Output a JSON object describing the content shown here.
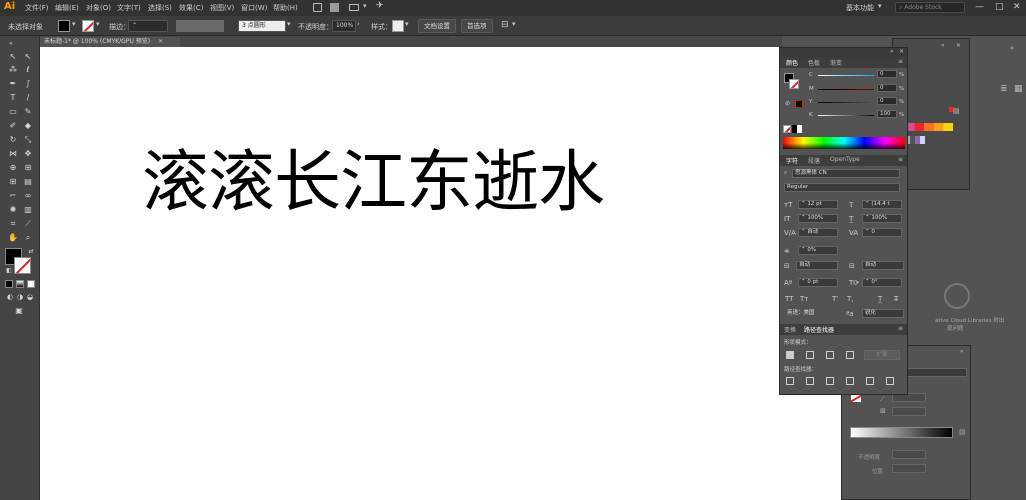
{
  "app": {
    "logo": "Ai"
  },
  "menubar": {
    "items": [
      "文件(F)",
      "编辑(E)",
      "对象(O)",
      "文字(T)",
      "选择(S)",
      "效果(C)",
      "视图(V)",
      "窗口(W)",
      "帮助(H)"
    ],
    "workspace": "基本功能",
    "search_placeholder": "Adobe Stock",
    "window_controls": [
      "—",
      "□",
      "✕"
    ]
  },
  "controlbar": {
    "selection_label": "未选择对象",
    "stroke_label": "描边：",
    "stroke_value": "",
    "brush_value": "3 点圆形",
    "opacity_label": "不透明度：",
    "opacity_value": "100%",
    "style_label": "样式：",
    "doc_settings_button": "文档设置",
    "preferences_button": "首选项"
  },
  "document": {
    "tab_title": "未标题-1* @ 100% (CMYK/GPU 预览)",
    "tab_close": "×",
    "artwork_text": "滚滚长江东逝水"
  },
  "color_panel": {
    "tabs": [
      "颜色",
      "色板",
      "渐变"
    ],
    "channels": [
      {
        "label": "C",
        "value": "0"
      },
      {
        "label": "M",
        "value": "0"
      },
      {
        "label": "Y",
        "value": "0"
      },
      {
        "label": "K",
        "value": "100"
      }
    ],
    "unit": "%"
  },
  "character_panel": {
    "tabs": [
      "字符",
      "段落",
      "OpenType"
    ],
    "font_family": "思源黑体 CN",
    "font_style": "Regular",
    "font_size": "12 pt",
    "leading": "(14.4 t",
    "vertical_scale": "100%",
    "horizontal_scale": "100%",
    "kerning": "自动",
    "tracking": "0",
    "tsume": "0%",
    "aki_left": "自动",
    "aki_right": "自动",
    "baseline_shift": "0 pt",
    "rotation": "0°",
    "language": "英语：美国",
    "anti_alias": "锐化"
  },
  "pathfinder_panel": {
    "tabs": [
      "变换",
      "路径查找器"
    ],
    "shape_modes_label": "形状模式：",
    "expand_button": "扩展",
    "pathfinders_label": "路径查找器："
  },
  "libraries_panel": {
    "hint_line1": "ative Cloud Libraries 时出",
    "hint_line2": "现问题"
  },
  "appearance_panel": {
    "label_opacity": "不透明度",
    "label_position": "位置"
  },
  "colors": {
    "accent_orange": "#ff9a00",
    "ui_dark": "#323232",
    "canvas": "#ffffff"
  }
}
